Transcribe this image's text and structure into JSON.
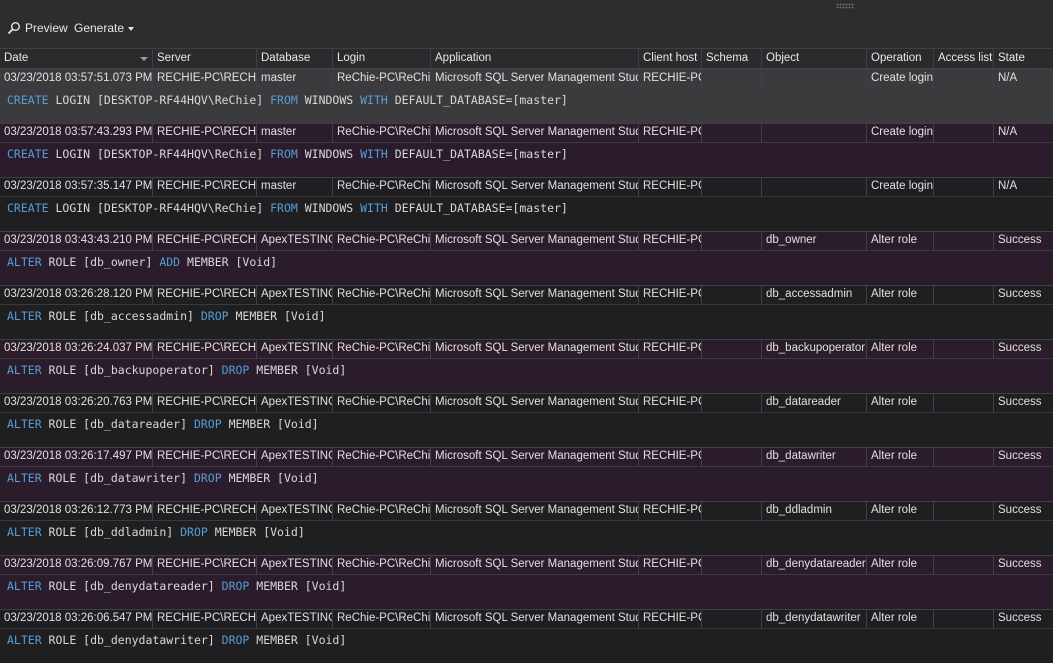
{
  "toolbar": {
    "preview_label": "Preview",
    "generate_label": "Generate"
  },
  "columns": [
    "Date",
    "Server",
    "Database",
    "Login",
    "Application",
    "Client host",
    "Schema",
    "Object",
    "Operation",
    "Access list",
    "State"
  ],
  "rows": [
    {
      "date": "03/23/2018 03:57:51.073 PM",
      "server": "RECHIE-PC\\RECHIE",
      "database": "master",
      "login": "ReChie-PC\\ReChie",
      "application": "Microsoft SQL Server Management Studio",
      "client_host": "RECHIE-PC",
      "schema": "",
      "object": "",
      "operation": "Create login",
      "access_list": "",
      "state": "N/A",
      "sql": [
        [
          "kw",
          "CREATE"
        ],
        [
          "t",
          " LOGIN [DESKTOP-RF44HQV\\ReChie] "
        ],
        [
          "kw",
          "FROM"
        ],
        [
          "t",
          " WINDOWS "
        ],
        [
          "kw",
          "WITH"
        ],
        [
          "t",
          " DEFAULT_DATABASE=[master]"
        ]
      ]
    },
    {
      "date": "03/23/2018 03:57:43.293 PM",
      "server": "RECHIE-PC\\RECHIE",
      "database": "master",
      "login": "ReChie-PC\\ReChie",
      "application": "Microsoft SQL Server Management Studio",
      "client_host": "RECHIE-PC",
      "schema": "",
      "object": "",
      "operation": "Create login",
      "access_list": "",
      "state": "N/A",
      "sql": [
        [
          "kw",
          "CREATE"
        ],
        [
          "t",
          " LOGIN [DESKTOP-RF44HQV\\ReChie] "
        ],
        [
          "kw",
          "FROM"
        ],
        [
          "t",
          " WINDOWS "
        ],
        [
          "kw",
          "WITH"
        ],
        [
          "t",
          " DEFAULT_DATABASE=[master]"
        ]
      ]
    },
    {
      "date": "03/23/2018 03:57:35.147 PM",
      "server": "RECHIE-PC\\RECHIE",
      "database": "master",
      "login": "ReChie-PC\\ReChie",
      "application": "Microsoft SQL Server Management Studio",
      "client_host": "RECHIE-PC",
      "schema": "",
      "object": "",
      "operation": "Create login",
      "access_list": "",
      "state": "N/A",
      "sql": [
        [
          "kw",
          "CREATE"
        ],
        [
          "t",
          " LOGIN [DESKTOP-RF44HQV\\ReChie] "
        ],
        [
          "kw",
          "FROM"
        ],
        [
          "t",
          " WINDOWS "
        ],
        [
          "kw",
          "WITH"
        ],
        [
          "t",
          " DEFAULT_DATABASE=[master]"
        ]
      ]
    },
    {
      "date": "03/23/2018 03:43:43.210 PM",
      "server": "RECHIE-PC\\RECHIE",
      "database": "ApexTESTING",
      "login": "ReChie-PC\\ReChie",
      "application": "Microsoft SQL Server Management Studio",
      "client_host": "RECHIE-PC",
      "schema": "",
      "object": "db_owner",
      "operation": "Alter role",
      "access_list": "",
      "state": "Success",
      "sql": [
        [
          "kw",
          "ALTER"
        ],
        [
          "t",
          " ROLE [db_owner] "
        ],
        [
          "kw",
          "ADD"
        ],
        [
          "t",
          " MEMBER [Void]"
        ]
      ]
    },
    {
      "date": "03/23/2018 03:26:28.120 PM",
      "server": "RECHIE-PC\\RECHIE",
      "database": "ApexTESTING",
      "login": "ReChie-PC\\ReChie",
      "application": "Microsoft SQL Server Management Studio",
      "client_host": "RECHIE-PC",
      "schema": "",
      "object": "db_accessadmin",
      "operation": "Alter role",
      "access_list": "",
      "state": "Success",
      "sql": [
        [
          "kw",
          "ALTER"
        ],
        [
          "t",
          " ROLE [db_accessadmin] "
        ],
        [
          "kw",
          "DROP"
        ],
        [
          "t",
          " MEMBER [Void]"
        ]
      ]
    },
    {
      "date": "03/23/2018 03:26:24.037 PM",
      "server": "RECHIE-PC\\RECHIE",
      "database": "ApexTESTING",
      "login": "ReChie-PC\\ReChie",
      "application": "Microsoft SQL Server Management Studio",
      "client_host": "RECHIE-PC",
      "schema": "",
      "object": "db_backupoperator",
      "operation": "Alter role",
      "access_list": "",
      "state": "Success",
      "sql": [
        [
          "kw",
          "ALTER"
        ],
        [
          "t",
          " ROLE [db_backupoperator] "
        ],
        [
          "kw",
          "DROP"
        ],
        [
          "t",
          " MEMBER [Void]"
        ]
      ]
    },
    {
      "date": "03/23/2018 03:26:20.763 PM",
      "server": "RECHIE-PC\\RECHIE",
      "database": "ApexTESTING",
      "login": "ReChie-PC\\ReChie",
      "application": "Microsoft SQL Server Management Studio",
      "client_host": "RECHIE-PC",
      "schema": "",
      "object": "db_datareader",
      "operation": "Alter role",
      "access_list": "",
      "state": "Success",
      "sql": [
        [
          "kw",
          "ALTER"
        ],
        [
          "t",
          " ROLE [db_datareader] "
        ],
        [
          "kw",
          "DROP"
        ],
        [
          "t",
          " MEMBER [Void]"
        ]
      ]
    },
    {
      "date": "03/23/2018 03:26:17.497 PM",
      "server": "RECHIE-PC\\RECHIE",
      "database": "ApexTESTING",
      "login": "ReChie-PC\\ReChie",
      "application": "Microsoft SQL Server Management Studio",
      "client_host": "RECHIE-PC",
      "schema": "",
      "object": "db_datawriter",
      "operation": "Alter role",
      "access_list": "",
      "state": "Success",
      "sql": [
        [
          "kw",
          "ALTER"
        ],
        [
          "t",
          " ROLE [db_datawriter] "
        ],
        [
          "kw",
          "DROP"
        ],
        [
          "t",
          " MEMBER [Void]"
        ]
      ]
    },
    {
      "date": "03/23/2018 03:26:12.773 PM",
      "server": "RECHIE-PC\\RECHIE",
      "database": "ApexTESTING",
      "login": "ReChie-PC\\ReChie",
      "application": "Microsoft SQL Server Management Studio",
      "client_host": "RECHIE-PC",
      "schema": "",
      "object": "db_ddladmin",
      "operation": "Alter role",
      "access_list": "",
      "state": "Success",
      "sql": [
        [
          "kw",
          "ALTER"
        ],
        [
          "t",
          " ROLE [db_ddladmin] "
        ],
        [
          "kw",
          "DROP"
        ],
        [
          "t",
          " MEMBER [Void]"
        ]
      ]
    },
    {
      "date": "03/23/2018 03:26:09.767 PM",
      "server": "RECHIE-PC\\RECHIE",
      "database": "ApexTESTING",
      "login": "ReChie-PC\\ReChie",
      "application": "Microsoft SQL Server Management Studio",
      "client_host": "RECHIE-PC",
      "schema": "",
      "object": "db_denydatareader",
      "operation": "Alter role",
      "access_list": "",
      "state": "Success",
      "sql": [
        [
          "kw",
          "ALTER"
        ],
        [
          "t",
          " ROLE [db_denydatareader] "
        ],
        [
          "kw",
          "DROP"
        ],
        [
          "t",
          " MEMBER [Void]"
        ]
      ]
    },
    {
      "date": "03/23/2018 03:26:06.547 PM",
      "server": "RECHIE-PC\\RECHIE",
      "database": "ApexTESTING",
      "login": "ReChie-PC\\ReChie",
      "application": "Microsoft SQL Server Management Studio",
      "client_host": "RECHIE-PC",
      "schema": "",
      "object": "db_denydatawriter",
      "operation": "Alter role",
      "access_list": "",
      "state": "Success",
      "sql": [
        [
          "kw",
          "ALTER"
        ],
        [
          "t",
          " ROLE [db_denydatawriter] "
        ],
        [
          "kw",
          "DROP"
        ],
        [
          "t",
          " MEMBER [Void]"
        ]
      ]
    }
  ],
  "colors": {
    "keyword": "#569cd6",
    "row_odd": "#2b1c2b",
    "row_even": "#1f1f22",
    "row_selected": "#3b3b3e"
  },
  "icons": {
    "preview": "magnifier-icon",
    "generate": "caret-down-icon",
    "sort": "sort-desc-icon"
  }
}
